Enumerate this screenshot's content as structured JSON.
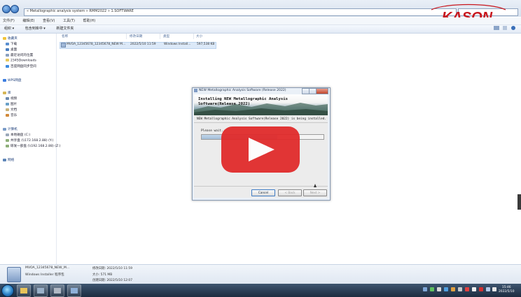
{
  "window": {
    "breadcrumb": "« Metallographic analysis system » RMM2022 » 1.SOFTWARE",
    "menu": [
      "文件(F)",
      "编辑(E)",
      "查看(V)",
      "工具(T)",
      "帮助(H)"
    ],
    "toolbar": [
      "组织 ▾",
      "包含到库中 ▾",
      "新建文件夹"
    ]
  },
  "logo": {
    "text": "KASON",
    "color": "#c8161d"
  },
  "sidebar": {
    "favorites_header": "收藏夹",
    "favorites": [
      "下载",
      "桌面",
      "最近访问的位置",
      "2345Downloads",
      "百度网盘同步空间"
    ],
    "wps_header": "WPS网盘",
    "library_header": "库",
    "libraries": [
      "视频",
      "图片",
      "文档",
      "音乐"
    ],
    "computer_header": "计算机",
    "drives": [
      "本地磁盘 (C:)",
      "共享盘 (\\\\172.168.2.88) (Y:)",
      "研发一部盘 (\\\\192.168.2.88) (Z:)"
    ],
    "network_header": "网络"
  },
  "file_list": {
    "columns": [
      "名称",
      "修改日期",
      "类型",
      "大小"
    ],
    "rows": [
      {
        "name": "MVOA_12345678_12345678_NEW M...",
        "modified": "2022/5/10 11:59",
        "type": "Windows Install...",
        "size": "597,538 KB"
      }
    ]
  },
  "dialog": {
    "title": "NEW Metallographic Analysis Software (Release 2022)",
    "banner_title": "Installing NEW Metallographic Analysis Software(Release 2022)",
    "status": "NEW Metallographic Analysis Software(Release 2022) is being installed.",
    "please_wait": "Please wait...",
    "progress": 0.62,
    "buttons": {
      "cancel": "Cancel",
      "back": "< Back",
      "next": "Next >"
    }
  },
  "video_overlay": {
    "color": "#e12a2a"
  },
  "details": {
    "filename": "MVOA_12345678_NEW_M...",
    "type": "Windows Installer 程序包",
    "modified": "修改日期: 2022/5/10 11:59",
    "size": "大小: 571 MB",
    "created": "创建日期: 2022/5/10 12:07"
  },
  "taskbar": {
    "time": "15:46",
    "date": "2022/5/10"
  }
}
